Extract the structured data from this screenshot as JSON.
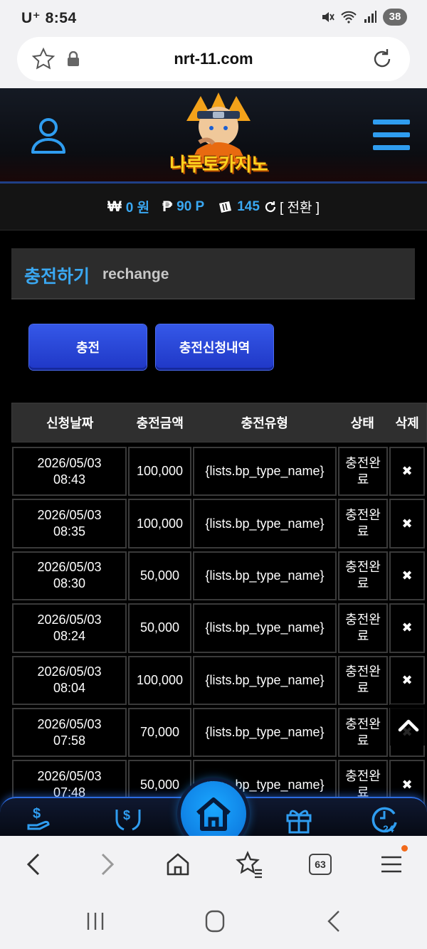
{
  "status_bar": {
    "carrier": "U⁺",
    "time": "8:54",
    "battery": "38"
  },
  "browser": {
    "url": "nrt-11.com",
    "tabs_count": "63"
  },
  "site": {
    "logo_text": "나루토카지노"
  },
  "balance": {
    "won_symbol": "₩",
    "won_value": "0 원",
    "point_symbol": "₱",
    "point_value": "90 P",
    "chip_value": "145",
    "convert_label": "[ 전환 ]"
  },
  "page": {
    "title_ko": "충전하기",
    "title_en": "rechange"
  },
  "tabs": {
    "charge": "충전",
    "history": "충전신청내역"
  },
  "table": {
    "headers": [
      "신청날짜",
      "충전금액",
      "충전유형",
      "상태",
      "삭제"
    ],
    "rows": [
      {
        "date": "2026/05/03",
        "time": "08:43",
        "amount": "100,000",
        "type": "{lists.bp_type_name}",
        "status": "충전완료"
      },
      {
        "date": "2026/05/03",
        "time": "08:35",
        "amount": "100,000",
        "type": "{lists.bp_type_name}",
        "status": "충전완료"
      },
      {
        "date": "2026/05/03",
        "time": "08:30",
        "amount": "50,000",
        "type": "{lists.bp_type_name}",
        "status": "충전완료"
      },
      {
        "date": "2026/05/03",
        "time": "08:24",
        "amount": "50,000",
        "type": "{lists.bp_type_name}",
        "status": "충전완료"
      },
      {
        "date": "2026/05/03",
        "time": "08:04",
        "amount": "100,000",
        "type": "{lists.bp_type_name}",
        "status": "충전완료"
      },
      {
        "date": "2026/05/03",
        "time": "07:58",
        "amount": "70,000",
        "type": "{lists.bp_type_name}",
        "status": "충전완료"
      },
      {
        "date": "2026/05/03",
        "time": "07:48",
        "amount": "50,000",
        "type": "{lists.bp_type_name}",
        "status": "충전완료"
      }
    ],
    "delete_glyph": "✖"
  },
  "bottom_nav": {
    "item_5_badge": "24"
  },
  "colors": {
    "accent": "#3aa8f2",
    "button": "#2a47d8",
    "nav_glow": "#2196ff"
  }
}
